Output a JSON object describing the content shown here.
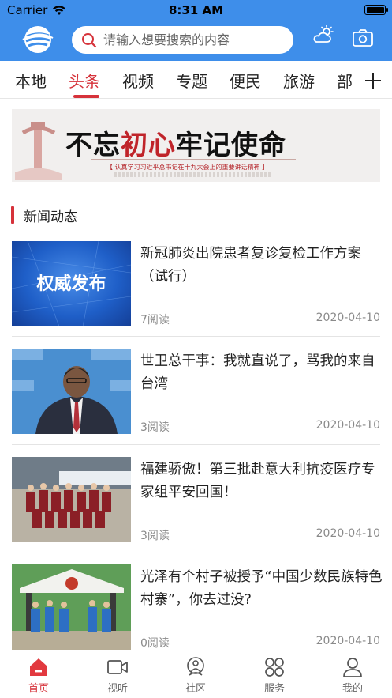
{
  "status_bar": {
    "carrier": "Carrier",
    "time": "8:31 AM"
  },
  "search": {
    "placeholder": "请输入想要搜索的内容"
  },
  "tabs": [
    {
      "label": "本地",
      "active": false
    },
    {
      "label": "头条",
      "active": true
    },
    {
      "label": "视频",
      "active": false
    },
    {
      "label": "专题",
      "active": false
    },
    {
      "label": "便民",
      "active": false
    },
    {
      "label": "旅游",
      "active": false
    },
    {
      "label": "部",
      "active": false
    }
  ],
  "banner": {
    "slogan_left": "不忘",
    "slogan_mid": "初心",
    "slogan_right": "牢记使命",
    "subtitle": "【 认真学习习近平总书记在十九大会上的重要讲话精神 】"
  },
  "section": {
    "title": "新闻动态"
  },
  "news": [
    {
      "title": "新冠肺炎出院患者复诊复检工作方案（试行）",
      "reads": "7阅读",
      "date": "2020-04-10",
      "thumb_text": "权威发布"
    },
    {
      "title": "世卫总干事：我就直说了，骂我的来自台湾",
      "reads": "3阅读",
      "date": "2020-04-10"
    },
    {
      "title": "福建骄傲！第三批赴意大利抗疫医疗专家组平安回国！",
      "reads": "3阅读",
      "date": "2020-04-10"
    },
    {
      "title": "光泽有个村子被授予“中国少数民族特色村寨”，你去过没?",
      "reads": "0阅读",
      "date": "2020-04-10"
    }
  ],
  "tabbar": [
    {
      "label": "首页",
      "icon": "home-icon",
      "active": true
    },
    {
      "label": "视听",
      "icon": "video-icon",
      "active": false
    },
    {
      "label": "社区",
      "icon": "community-icon",
      "active": false
    },
    {
      "label": "服务",
      "icon": "services-icon",
      "active": false
    },
    {
      "label": "我的",
      "icon": "profile-icon",
      "active": false
    }
  ],
  "colors": {
    "header": "#3e8eea",
    "accent": "#d6323a"
  }
}
